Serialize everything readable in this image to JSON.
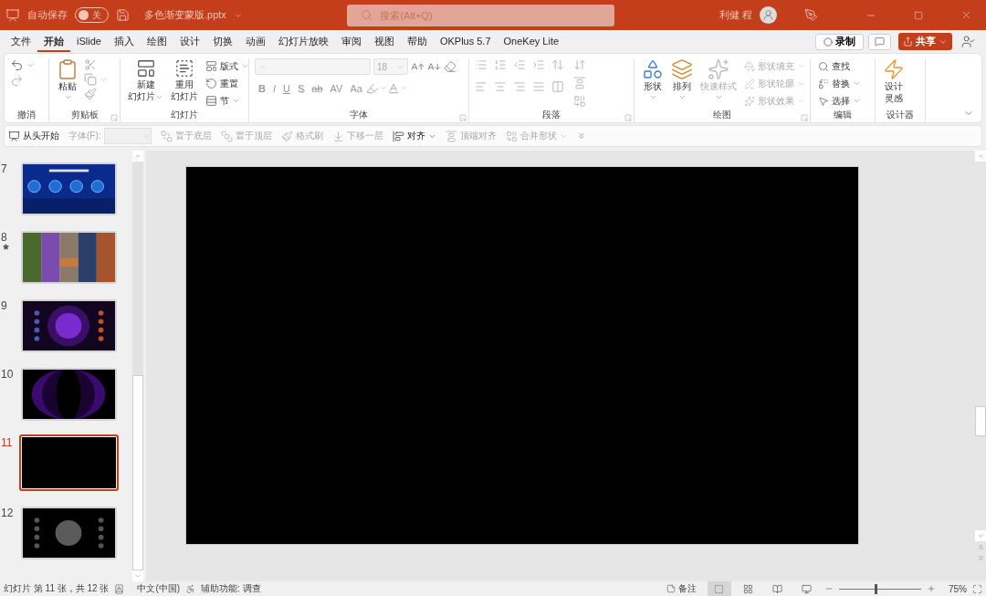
{
  "title_bar": {
    "autosave_label": "自动保存",
    "autosave": {
      "label": "关",
      "on": false
    },
    "filename": "多色渐变蒙版.pptx",
    "search": {
      "placeholder": "搜索(Alt+Q)"
    },
    "user": "利健 程"
  },
  "tabs": [
    {
      "label": "文件",
      "selected": false
    },
    {
      "label": "开始",
      "selected": true
    },
    {
      "label": "iSlide",
      "selected": false
    },
    {
      "label": "插入",
      "selected": false
    },
    {
      "label": "绘图",
      "selected": false
    },
    {
      "label": "设计",
      "selected": false
    },
    {
      "label": "切换",
      "selected": false
    },
    {
      "label": "动画",
      "selected": false
    },
    {
      "label": "幻灯片放映",
      "selected": false
    },
    {
      "label": "审阅",
      "selected": false
    },
    {
      "label": "视图",
      "selected": false
    },
    {
      "label": "帮助",
      "selected": false
    },
    {
      "label": "OKPlus 5.7",
      "selected": false
    },
    {
      "label": "OneKey Lite",
      "selected": false
    }
  ],
  "tab_actions": {
    "record": "录制",
    "share": "共享"
  },
  "ribbon": {
    "undo": {
      "label": "撤消"
    },
    "clipboard": {
      "label": "剪贴板",
      "paste": "粘贴"
    },
    "slides": {
      "label": "幻灯片",
      "large": [
        {
          "lines": [
            "新建",
            "幻灯片"
          ],
          "dropdown": true
        },
        {
          "lines": [
            "重用",
            "幻灯片"
          ],
          "dropdown": false
        }
      ],
      "small": [
        {
          "label": "版式",
          "dropdown": true
        },
        {
          "label": "重置",
          "dropdown": false
        },
        {
          "label": "节",
          "dropdown": true
        }
      ]
    },
    "font": {
      "label": "字体",
      "size": "18",
      "formats": [
        {
          "label": "B",
          "kind": "bold"
        },
        {
          "label": "I",
          "kind": "italic"
        },
        {
          "label": "U",
          "kind": "underline"
        },
        {
          "label": "S",
          "kind": "shadow"
        },
        {
          "label": "ab",
          "kind": "strike"
        },
        {
          "label": "AV",
          "kind": "spacing"
        },
        {
          "label": "Aa",
          "kind": "case"
        }
      ]
    },
    "paragraph": {
      "label": "段落"
    },
    "drawing": {
      "label": "绘图",
      "large": [
        {
          "label": "形状",
          "disabled": false
        },
        {
          "label": "排列",
          "disabled": false
        },
        {
          "label": "快速样式",
          "disabled": true
        }
      ],
      "small": [
        {
          "label": "形状填充",
          "disabled": true
        },
        {
          "label": "形状轮廓",
          "disabled": true
        },
        {
          "label": "形状效果",
          "disabled": true
        }
      ]
    },
    "editing": {
      "label": "编辑",
      "items": [
        {
          "label": "查找",
          "dropdown": false
        },
        {
          "label": "替换",
          "dropdown": true
        },
        {
          "label": "选择",
          "dropdown": true
        }
      ]
    },
    "designer": {
      "label": "设计器",
      "lines": [
        "设计",
        "灵感"
      ]
    }
  },
  "toolbar": [
    {
      "label": "从头开始",
      "kind": "button",
      "disabled": false
    },
    {
      "label": "字体(F):",
      "kind": "field",
      "disabled": true
    },
    {
      "label": "置于底层",
      "kind": "button",
      "disabled": true
    },
    {
      "label": "置于顶层",
      "kind": "button",
      "disabled": true
    },
    {
      "label": "格式刷",
      "kind": "button",
      "disabled": true
    },
    {
      "label": "下移一层",
      "kind": "button",
      "disabled": true
    },
    {
      "label": "对齐",
      "kind": "menu",
      "disabled": false
    },
    {
      "label": "顶端对齐",
      "kind": "button",
      "disabled": true
    },
    {
      "label": "合并形状",
      "kind": "menu",
      "disabled": true
    }
  ],
  "slides": [
    {
      "number": "7",
      "kind": "picture",
      "starred": false,
      "selected": false
    },
    {
      "number": "8",
      "kind": "picture",
      "starred": true,
      "selected": false
    },
    {
      "number": "9",
      "kind": "picture",
      "starred": false,
      "selected": false
    },
    {
      "number": "10",
      "kind": "picture",
      "starred": false,
      "selected": false
    },
    {
      "number": "11",
      "kind": "blank",
      "starred": false,
      "selected": true
    },
    {
      "number": "12",
      "kind": "picture",
      "starred": false,
      "selected": false
    }
  ],
  "status_bar": {
    "slide_info": "幻灯片 第 11 张，共 12 张",
    "language": "中文(中国)",
    "accessibility": "辅助功能: 调查",
    "notes": "备注",
    "views": [
      {
        "kind": "normal",
        "selected": true
      },
      {
        "kind": "sorter",
        "selected": false
      },
      {
        "kind": "reading",
        "selected": false
      },
      {
        "kind": "show",
        "selected": false
      }
    ],
    "zoom": {
      "level": 0.45,
      "reading": "75%"
    }
  }
}
